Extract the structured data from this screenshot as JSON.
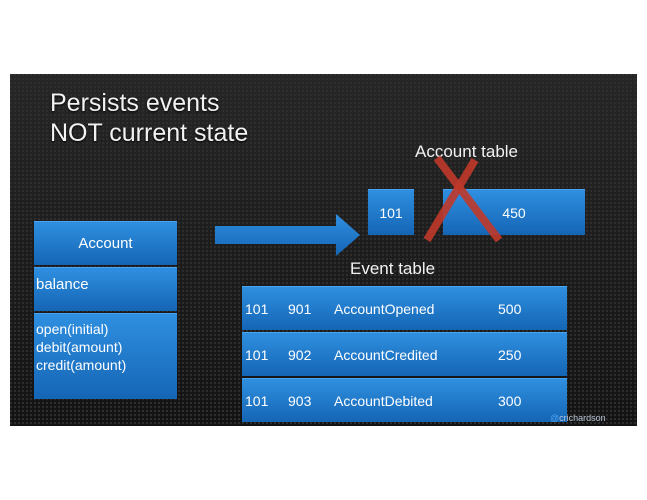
{
  "title": {
    "line1": "Persists events",
    "line2": "NOT current state"
  },
  "account_class": {
    "name": "Account",
    "field": "balance",
    "methods": [
      "open(initial)",
      "debit(amount)",
      "credit(amount)"
    ]
  },
  "account_table": {
    "label": "Account table",
    "cells": [
      "101",
      "450"
    ]
  },
  "event_table": {
    "label": "Event table",
    "rows": [
      [
        "101",
        "901",
        "AccountOpened",
        "500"
      ],
      [
        "101",
        "902",
        "AccountCredited",
        "250"
      ],
      [
        "101",
        "903",
        "AccountDebited",
        "300"
      ]
    ]
  },
  "footer": {
    "at": "@",
    "handle": "crichardson"
  },
  "colors": {
    "box_blue": "#1f77cf",
    "cross_red": "#c0392b",
    "background": "#1c1c1c"
  }
}
